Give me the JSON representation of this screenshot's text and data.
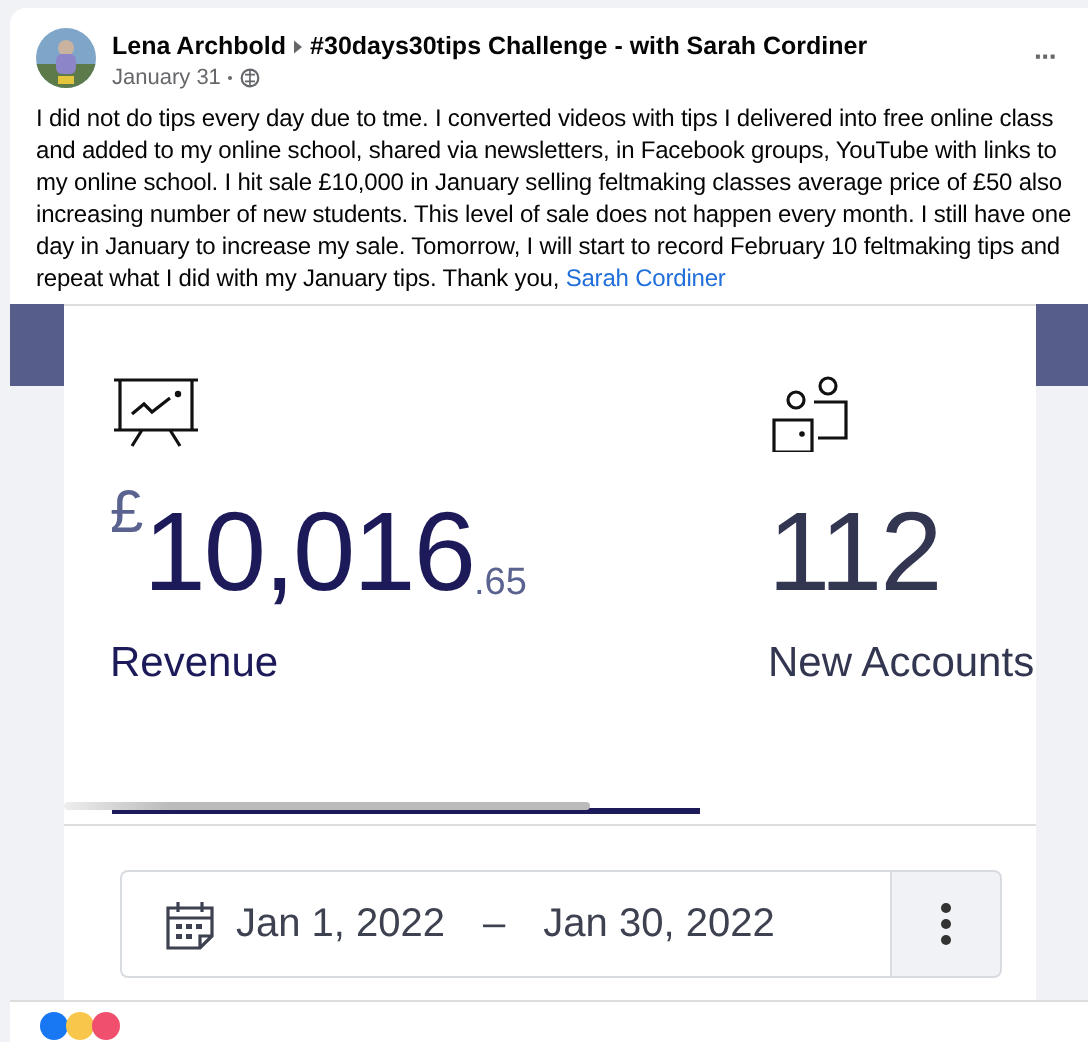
{
  "post": {
    "author": "Lena Archbold",
    "group": "#30days30tips Challenge - with Sarah Cordiner",
    "date": "January 31",
    "menu": "···",
    "text": "I did not do tips every day due to tme. I converted videos with tips I delivered into free online class and added to my online school, shared via newsletters, in Facebook groups, YouTube with links to my online school. I hit sale £10,000 in January selling feltmaking classes average price of £50 also increasing number of new students. This level of sale does not happen every month. I still have one day in January to increase my sale. Tomorrow, I will start to record February 10 feltmaking tips and repeat what I did with my January tips. Thank you,",
    "mention": "Sarah Cordiner"
  },
  "dashboard": {
    "stats": [
      {
        "kind": "revenue",
        "currency": "£",
        "value": "10,016",
        "decimals": ".65",
        "label": "Revenue",
        "selected": true
      },
      {
        "kind": "accounts",
        "value": "112",
        "label": "New Accounts",
        "selected": false
      }
    ],
    "date_range": {
      "start": "Jan 1, 2022",
      "separator": "–",
      "end": "Jan 30, 2022"
    }
  }
}
